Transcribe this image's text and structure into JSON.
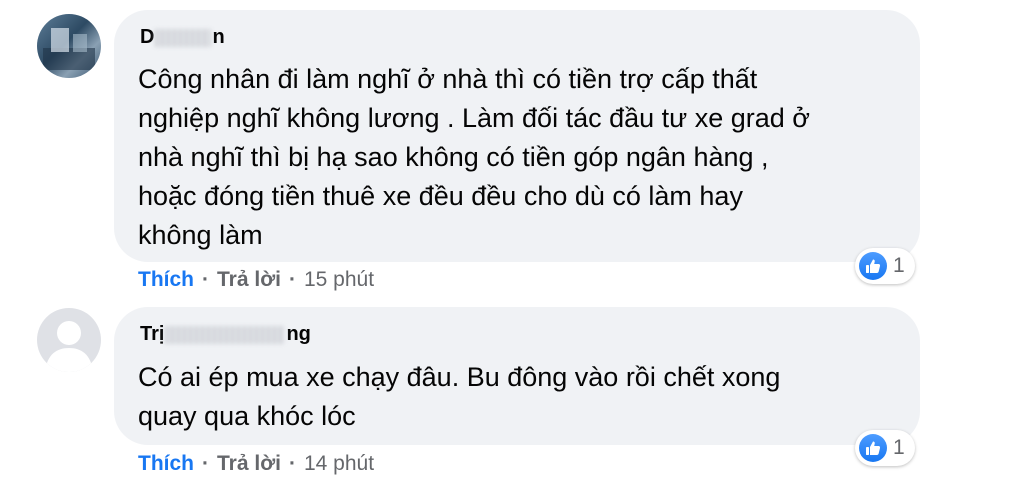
{
  "comments": [
    {
      "author_start": "D",
      "author_end": "n",
      "body_lines": [
        "Công nhân đi làm nghĩ ở nhà thì có tiền trợ cấp thất",
        "nghiệp nghĩ không lương . Làm đối tác đầu tư xe grad ở",
        "nhà nghĩ thì bị hạ sao không có tiền góp ngân hàng ,",
        "hoặc đóng tiền thuê xe đều đều cho dù có làm hay",
        "không làm"
      ],
      "like_label": "Thích",
      "reply_label": "Trả lời",
      "separator": "·",
      "time": "15 phút",
      "reaction_count": "1",
      "reaction_icon": "thumbs-up-icon"
    },
    {
      "author_start": "Trị",
      "author_end": "ng",
      "body_lines": [
        "Có ai ép mua xe chạy đâu. Bu đông vào rồi chết xong",
        "quay qua khóc lóc"
      ],
      "like_label": "Thích",
      "reply_label": "Trả lời",
      "separator": "·",
      "time": "14 phút",
      "reaction_count": "1",
      "reaction_icon": "thumbs-up-icon"
    }
  ],
  "colors": {
    "bubble_bg": "#f0f2f5",
    "like_blue": "#1877f2",
    "meta_gray": "#65676b",
    "text": "#050505"
  }
}
